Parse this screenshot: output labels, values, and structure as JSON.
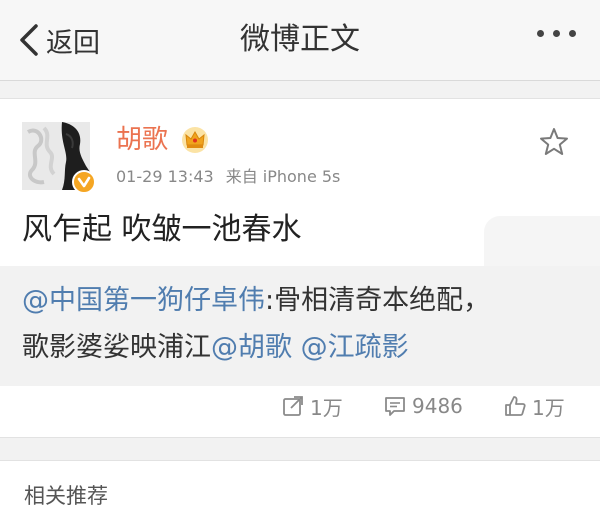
{
  "nav": {
    "back_label": "返回",
    "title": "微博正文"
  },
  "post": {
    "username": "胡歌",
    "timestamp": "01-29 13:43",
    "source": "来自 iPhone 5s",
    "text": "风乍起 吹皱一池春水"
  },
  "repost": {
    "line1_mention": "@中国第一狗仔卓伟",
    "line1_text": ":骨相清奇本绝配，",
    "line2_text": "歌影婆娑映浦江",
    "line2_mention1": "@胡歌",
    "line2_mention2": "@江疏影"
  },
  "actions": {
    "repost_count": "1万",
    "comment_count": "9486",
    "like_count": "1万"
  },
  "recommend": {
    "label": "相关推荐"
  },
  "colors": {
    "username": "#eb7350",
    "mention": "#507daf",
    "badge": "#f5a623"
  },
  "icons": [
    "back-chevron-icon",
    "more-icon",
    "vip-crown-icon",
    "verified-badge-icon",
    "favorite-star-icon",
    "repost-icon",
    "comment-icon",
    "like-icon"
  ]
}
